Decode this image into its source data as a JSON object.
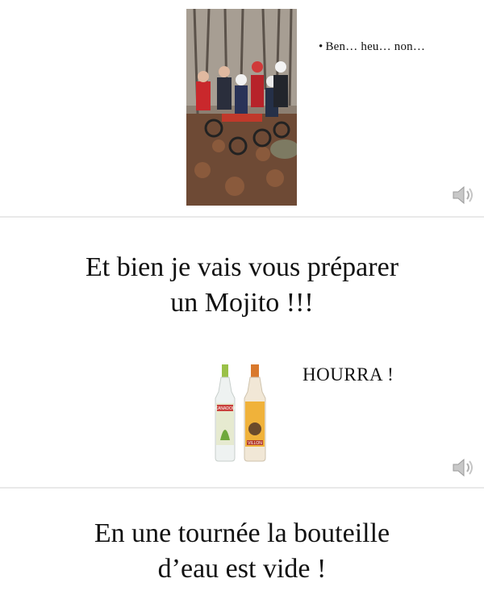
{
  "slides": [
    {
      "photo_icon": "group-photo-image",
      "bullet_text": "Ben… heu… non…",
      "audio_icon": "speaker-icon"
    },
    {
      "heading_line1": "Et bien je vais vous préparer",
      "heading_line2": "un Mojito !!!",
      "bottle_icon": "rum-bottles-image",
      "bottle_labels": [
        "CANADOU",
        "VILLON"
      ],
      "exclamation": "HOURRA !",
      "audio_icon": "speaker-icon"
    },
    {
      "heading_line1": "En une tournée la bouteille",
      "heading_line2": "d’eau est vide !"
    }
  ],
  "colors": {
    "background": "#e9e9e9",
    "slide": "#ffffff",
    "text": "#111111"
  }
}
